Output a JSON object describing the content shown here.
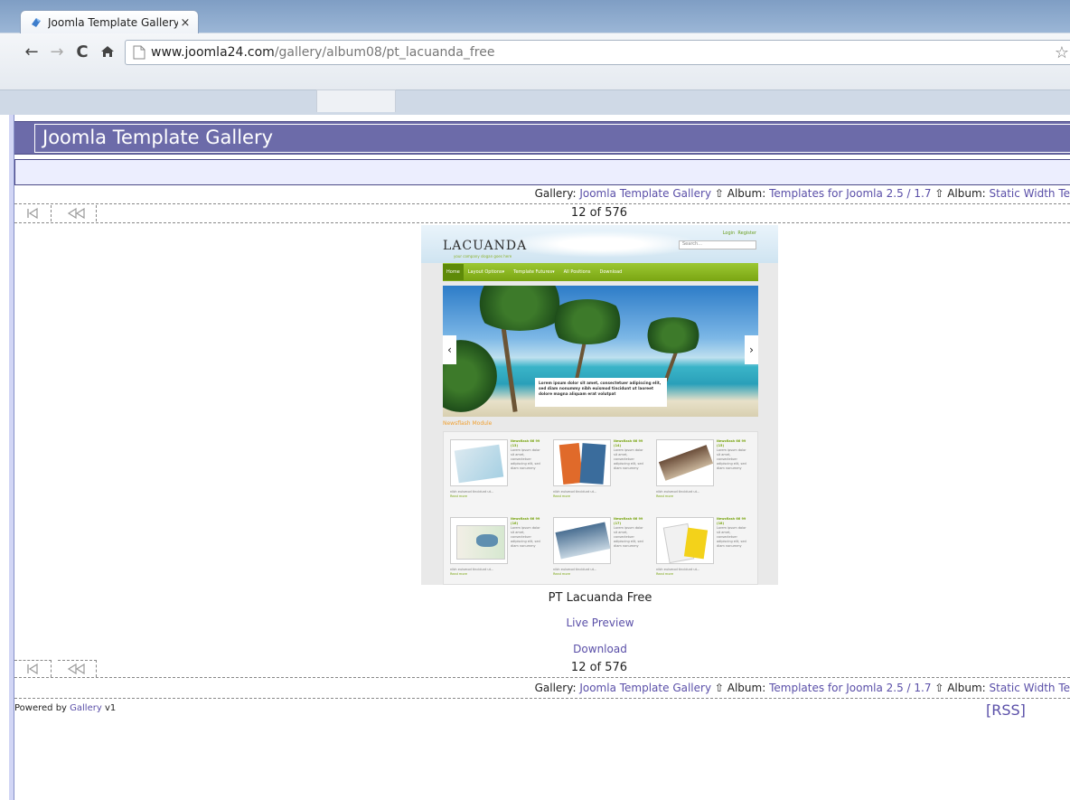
{
  "browser": {
    "tab_title": "Joomla Template Gallery",
    "tab_close": "×",
    "tab_ellipsis": "::",
    "url_domain": "www.joomla24.com",
    "url_path": "/gallery/album08/pt_lacuanda_free",
    "icons": [
      "back-arrow-icon",
      "forward-arrow-icon",
      "reload-icon",
      "home-icon",
      "page-icon",
      "star-icon"
    ]
  },
  "header": {
    "title": "Joomla Template Gallery"
  },
  "breadcrumb": {
    "gallery_label": "Gallery: ",
    "gallery_link": "Joomla Template Gallery",
    "album_label": " Album: ",
    "album_link": "Templates for Joomla 2.5 / 1.7",
    "album2_label": " Album: ",
    "album2_link": "Static Width Te"
  },
  "navigation": {
    "counter": "12 of 576"
  },
  "preview": {
    "logo": "LACUANDA",
    "logo_sub": "your company slogan goes here",
    "login": "Login",
    "register": "Register",
    "search_placeholder": "Search...",
    "menu": [
      "Home",
      "Layout Options▾",
      "Template Futures▾",
      "All Positions",
      "Download"
    ],
    "caption": "Lorem ipsum dolor sit amet, consectetuer adipiscing elit, sed diam nonummy nibh euismod tincidunt ut laoreet dolore magna aliquam erat volutpat",
    "module_title": "Newsflash Module",
    "cards": [
      {
        "title": "Newsflash 66 99 (13)",
        "text": "Lorem ipsum dolor sit amet, consectetuer adipiscing elit, sed diam nonummy",
        "foot": "nibh euismod tincidunt ut...",
        "more": "Read more"
      },
      {
        "title": "Newsflash 66 99 (14)",
        "text": "Lorem ipsum dolor sit amet, consectetuer adipiscing elit, sed diam nonummy",
        "foot": "nibh euismod tincidunt ut...",
        "more": "Read more"
      },
      {
        "title": "Newsflash 66 99 (15)",
        "text": "Lorem ipsum dolor sit amet, consectetuer adipiscing elit, sed diam nonummy",
        "foot": "nibh euismod tincidunt ut...",
        "more": "Read more"
      },
      {
        "title": "Newsflash 66 99 (16)",
        "text": "Lorem ipsum dolor sit amet, consectetuer adipiscing elit, sed diam nonummy",
        "foot": "nibh euismod tincidunt ut...",
        "more": "Read more"
      },
      {
        "title": "Newsflash 66 99 (17)",
        "text": "Lorem ipsum dolor sit amet, consectetuer adipiscing elit, sed diam nonummy",
        "foot": "nibh euismod tincidunt ut...",
        "more": "Read more"
      },
      {
        "title": "Newsflash 66 99 (18)",
        "text": "Lorem ipsum dolor sit amet, consectetuer adipiscing elit, sed diam nonummy",
        "foot": "nibh euismod tincidunt ut...",
        "more": "Read more"
      }
    ]
  },
  "item": {
    "title": "PT Lacuanda Free",
    "live_preview": "Live Preview",
    "download": "Download"
  },
  "footer": {
    "powered_prefix": "Powered by ",
    "powered_link": "Gallery",
    "powered_version": " v1",
    "rss": "[RSS]"
  },
  "colors": {
    "header_bg": "#6c6ba9",
    "link": "#5a4fa8",
    "subbar_bg": "#eceefe"
  }
}
